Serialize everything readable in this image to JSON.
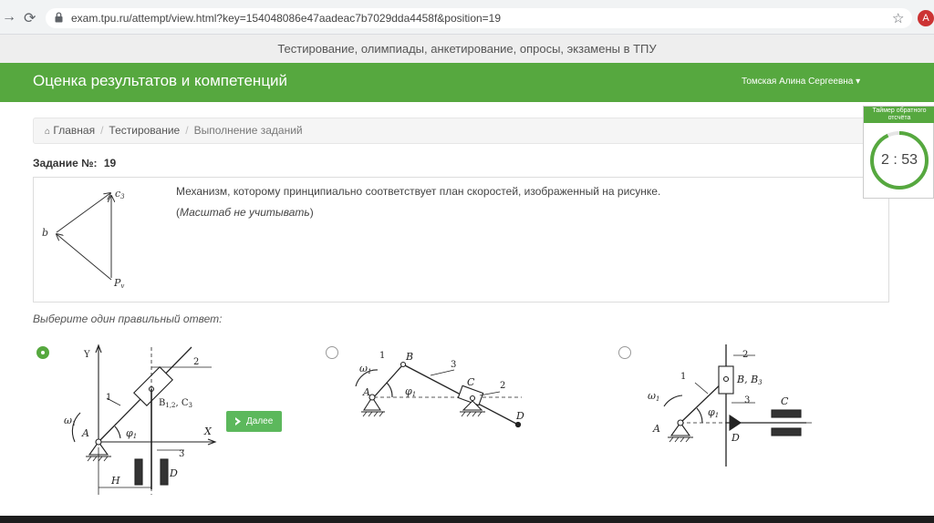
{
  "browser": {
    "url": "exam.tpu.ru/attempt/view.html?key=154048086e47aadeac7b7029dda4458f&position=19",
    "profile_initial": "A"
  },
  "site": {
    "tagline": "Тестирование, олимпиады, анкетирование, опросы, экзамены в ТПУ",
    "brand": "Оценка результатов и компетенций",
    "user": "Томская Алина Сергеевна ▾"
  },
  "breadcrumb": {
    "home": "Главная",
    "testing": "Тестирование",
    "current": "Выполнение заданий"
  },
  "task": {
    "label": "Задание №:",
    "number": "19",
    "question": "Механизм, которому принципиально соответствует план скоростей, изображенный на рисунке.",
    "note_open": "(",
    "note": "Масштаб не учитывать",
    "note_close": ")",
    "diagram_labels": {
      "c3": "c",
      "c3_sub": "3",
      "b": "b",
      "pv": "P",
      "pv_sub": "v"
    }
  },
  "answers": {
    "prompt": "Выберите один правильный ответ:",
    "next_label": "Далее",
    "options": [
      {
        "selected": true,
        "labels": {
          "y": "Y",
          "x": "X",
          "one": "1",
          "two": "2",
          "three": "3",
          "a": "A",
          "d": "D",
          "h": "H",
          "omega": "ω",
          "omega_sub": "1",
          "phi": "φ",
          "phi_sub": "1",
          "b": "B",
          "b_sub": "1,2",
          "c": ", C",
          "c_sub": "3"
        }
      },
      {
        "selected": false,
        "labels": {
          "one": "1",
          "two": "2",
          "three": "3",
          "a": "A",
          "b": "B",
          "c": "C",
          "d": "D",
          "omega": "ω",
          "omega_sub": "1",
          "phi": "φ",
          "phi_sub": "1"
        }
      },
      {
        "selected": false,
        "labels": {
          "one": "1",
          "two": "2",
          "three": "3",
          "a": "A",
          "b": "B, B",
          "b_sub": "3",
          "c": "C",
          "d": "D",
          "omega": "ω",
          "omega_sub": "1",
          "phi": "φ",
          "phi_sub": "1"
        }
      }
    ]
  },
  "timer": {
    "title": "Таймер обратного отсчёта",
    "value": "2 : 53",
    "remaining_fraction": 0.93
  },
  "colors": {
    "accent": "#56a83f",
    "button": "#5cb85c"
  }
}
